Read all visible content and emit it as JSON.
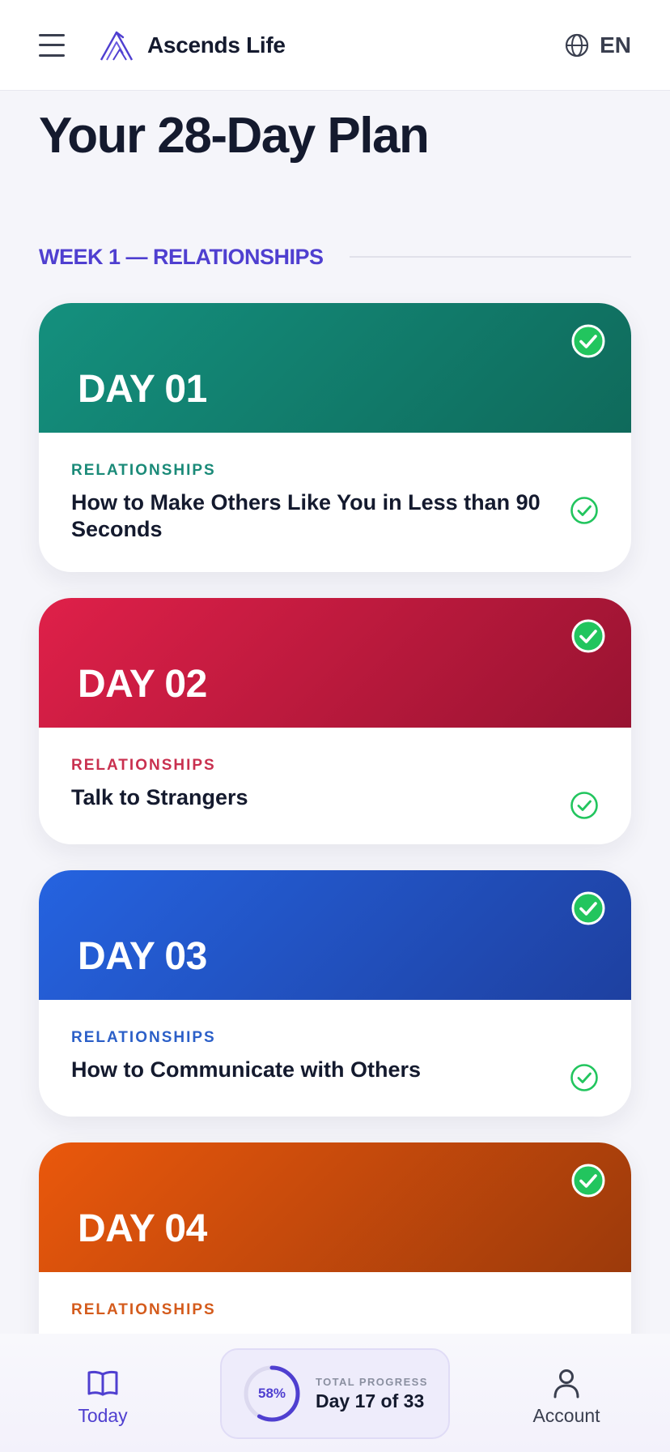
{
  "header": {
    "brand": "Ascends Life",
    "language": "EN"
  },
  "page": {
    "title": "Your 28-Day Plan"
  },
  "week": {
    "label": "WEEK 1 — RELATIONSHIPS"
  },
  "days": [
    {
      "label": "DAY 01",
      "category": "RELATIONSHIPS",
      "title": "How to Make Others Like You in Less than 90 Seconds",
      "completed": true,
      "gradient": [
        "#14907e",
        "#0f6a5b"
      ],
      "category_color": "#1a8a78"
    },
    {
      "label": "DAY 02",
      "category": "RELATIONSHIPS",
      "title": "Talk to Strangers",
      "completed": true,
      "gradient": [
        "#df2049",
        "#981331"
      ],
      "category_color": "#c9304f"
    },
    {
      "label": "DAY 03",
      "category": "RELATIONSHIPS",
      "title": "How to Communicate with Others",
      "completed": true,
      "gradient": [
        "#2563e0",
        "#1e40a0"
      ],
      "category_color": "#2b5fc8"
    },
    {
      "label": "DAY 04",
      "category": "RELATIONSHIPS",
      "title": "",
      "completed": true,
      "gradient": [
        "#ea580c",
        "#9c3a0b"
      ],
      "category_color": "#d45b1c"
    }
  ],
  "nav": {
    "today": "Today",
    "account": "Account",
    "progress_percent": 58,
    "progress_label": "58%",
    "progress_caption": "TOTAL PROGRESS",
    "progress_value": "Day 17 of 33"
  },
  "colors": {
    "accent": "#4f3fd0",
    "check": "#22c55e"
  }
}
